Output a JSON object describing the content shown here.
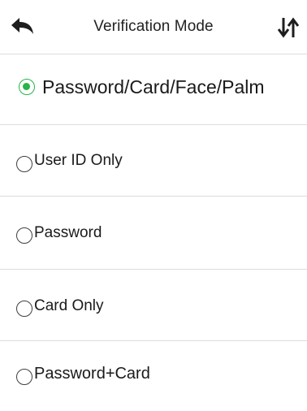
{
  "header": {
    "title": "Verification Mode",
    "back_icon": "back-arrow-icon",
    "sort_icon": "sort-arrows-icon"
  },
  "accent_color": "#27b44a",
  "options": [
    {
      "label": "Password/Card/Face/Palm",
      "selected": true
    },
    {
      "label": "User ID Only",
      "selected": false
    },
    {
      "label": "Password",
      "selected": false
    },
    {
      "label": "Card Only",
      "selected": false
    },
    {
      "label": "Password+Card",
      "selected": false
    }
  ]
}
